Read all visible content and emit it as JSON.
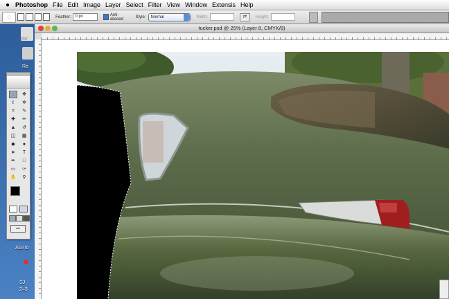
{
  "menubar": {
    "app_name": "Photoshop",
    "items": [
      "File",
      "Edit",
      "Image",
      "Layer",
      "Select",
      "Filter",
      "View",
      "Window",
      "Extensis",
      "Help"
    ]
  },
  "options_bar": {
    "feather_label": "Feather:",
    "feather_value": "0 px",
    "anti_aliased_label": "Anti-aliased",
    "style_label": "Style:",
    "style_value": "Normal",
    "width_label": "Width:",
    "height_label": "Height:"
  },
  "desktop": {
    "labels": [
      "Inv",
      "Re",
      "AGI lo",
      "SJ",
      "2–3"
    ]
  },
  "document": {
    "title": "tucker.psd @ 25% (Layer 8, CMYK/8)"
  },
  "toolbox": {
    "tools": [
      "rect-marquee",
      "move",
      "lasso",
      "magic-wand",
      "crop",
      "slice",
      "healing",
      "brush",
      "stamp",
      "history-brush",
      "eraser",
      "gradient",
      "blur",
      "dodge",
      "path-select",
      "type",
      "pen",
      "shape",
      "notes",
      "eyedropper",
      "hand",
      "zoom"
    ],
    "glyphs": [
      "◌",
      "✥",
      "ℓ",
      "✲",
      "⌗",
      "✎",
      "✚",
      "✏",
      "▲",
      "↺",
      "◫",
      "▦",
      "◆",
      "●",
      "➤",
      "T",
      "✒",
      "□",
      "▭",
      "✑",
      "✋",
      "⚲"
    ]
  },
  "colors": {
    "foreground": "#000000",
    "background": "#ffffff",
    "car_body": "#5e6e4c"
  }
}
